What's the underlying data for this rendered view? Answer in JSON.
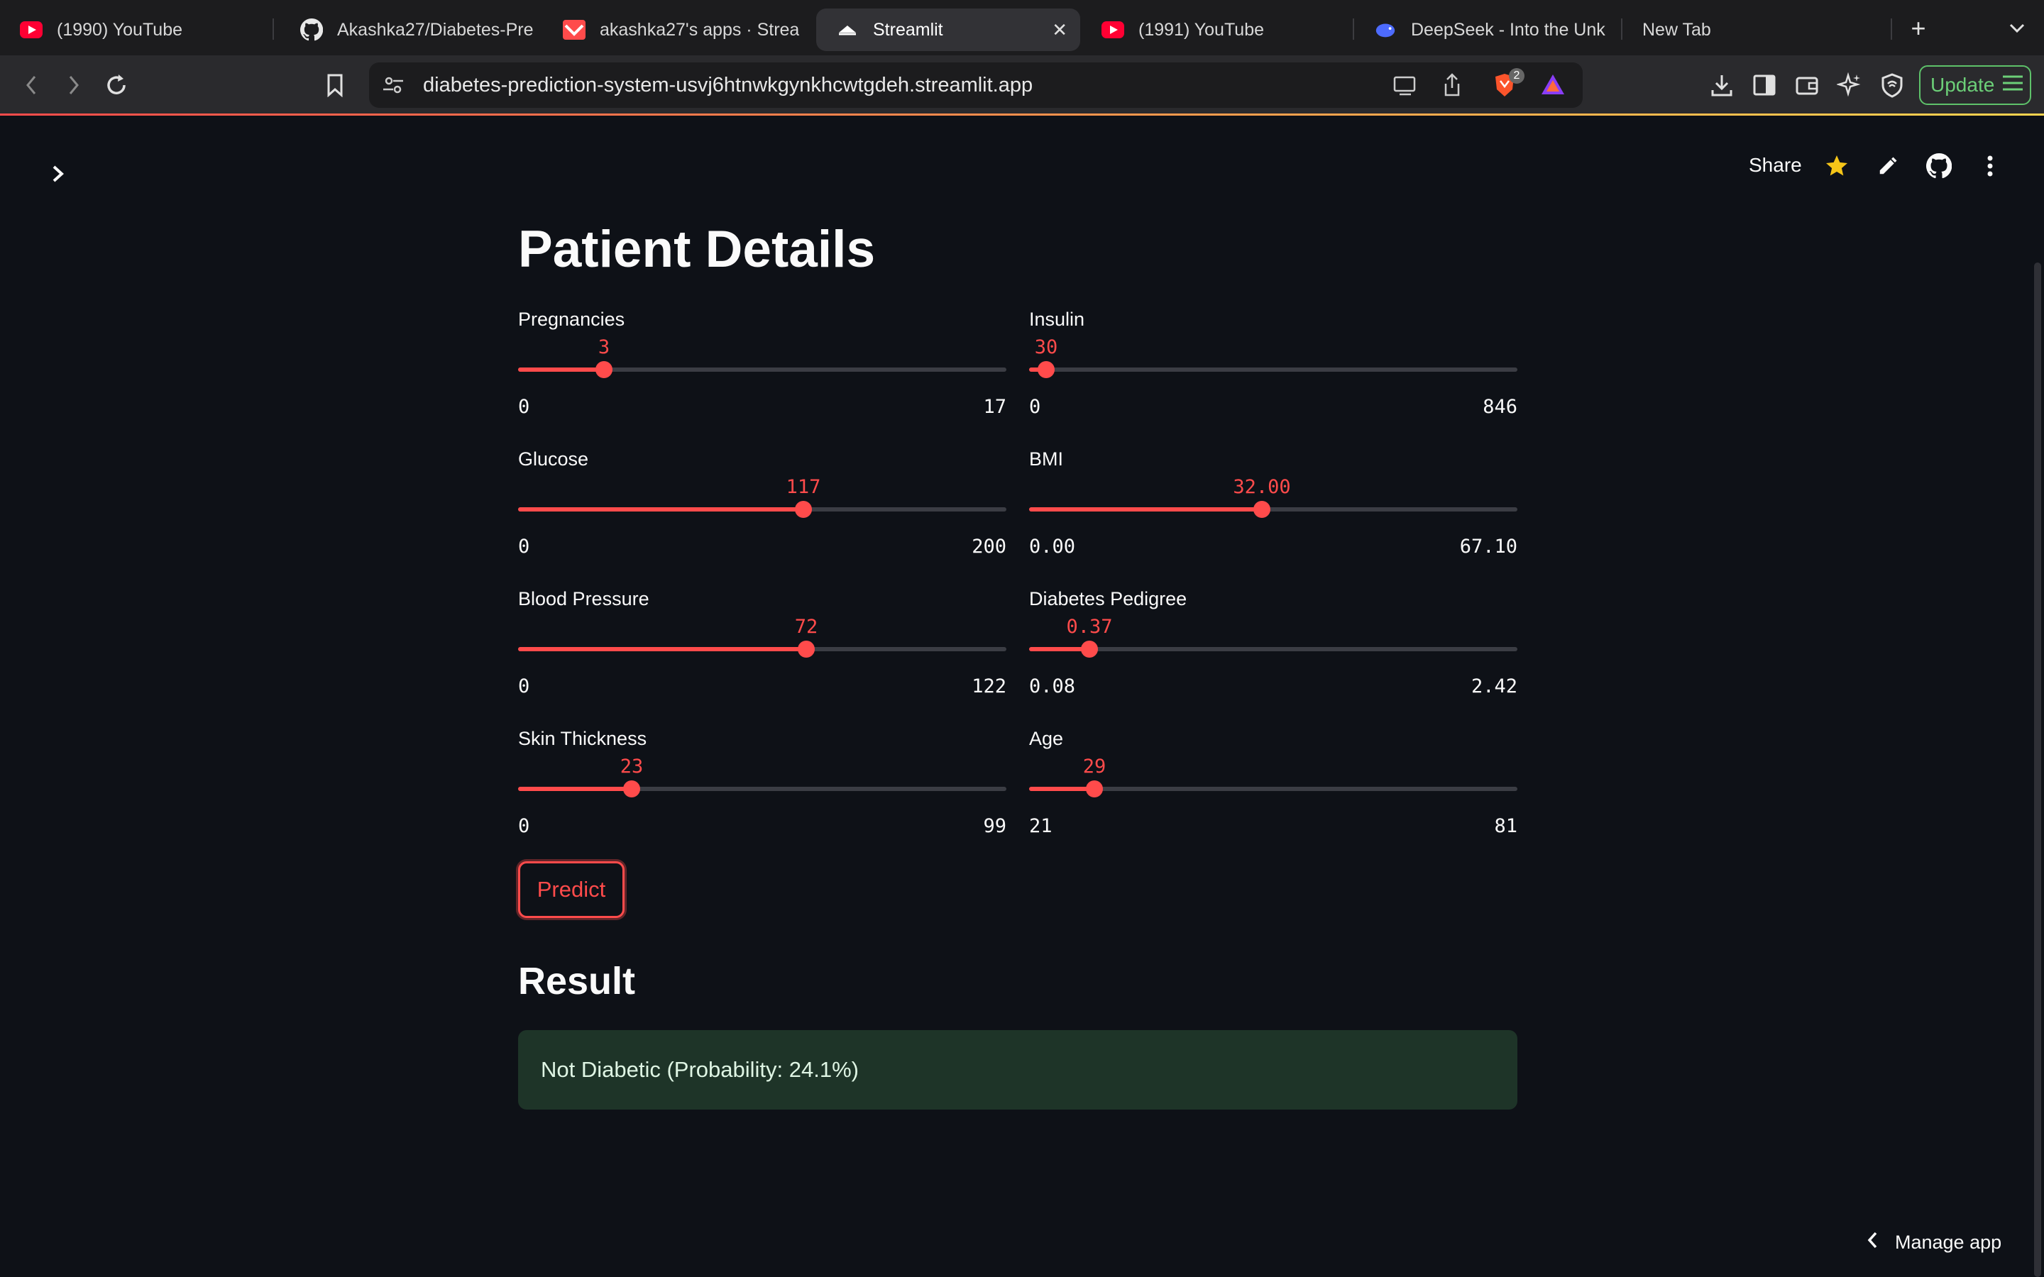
{
  "browser": {
    "tabs": [
      {
        "title": "(1990) YouTube",
        "icon": "youtube-icon",
        "active": false
      },
      {
        "title": "Akashka27/Diabetes-Pre",
        "icon": "github-icon",
        "active": false
      },
      {
        "title": "akashka27's apps · Strea",
        "icon": "streamlit-icon",
        "active": false
      },
      {
        "title": "Streamlit",
        "icon": "streamlit-icon",
        "active": true
      },
      {
        "title": "(1991) YouTube",
        "icon": "youtube-icon",
        "active": false
      },
      {
        "title": "DeepSeek - Into the Unk",
        "icon": "deepseek-icon",
        "active": false
      },
      {
        "title": "New Tab",
        "icon": "",
        "active": false
      }
    ],
    "url": "diabetes-prediction-system-usvj6htnwkgynkhcwtgdeh.streamlit.app",
    "shields_count": "2",
    "update_label": "Update"
  },
  "app_header": {
    "share_label": "Share"
  },
  "page": {
    "title": "Patient Details",
    "accent_color": "#ff4b4b",
    "sliders": [
      {
        "label": "Pregnancies",
        "value": "3",
        "min": "0",
        "max": "17",
        "fraction": 0.176
      },
      {
        "label": "Insulin",
        "value": "30",
        "min": "0",
        "max": "846",
        "fraction": 0.035
      },
      {
        "label": "Glucose",
        "value": "117",
        "min": "0",
        "max": "200",
        "fraction": 0.585
      },
      {
        "label": "BMI",
        "value": "32.00",
        "min": "0.00",
        "max": "67.10",
        "fraction": 0.477
      },
      {
        "label": "Blood Pressure",
        "value": "72",
        "min": "0",
        "max": "122",
        "fraction": 0.59
      },
      {
        "label": "Diabetes Pedigree",
        "value": "0.37",
        "min": "0.08",
        "max": "2.42",
        "fraction": 0.124
      },
      {
        "label": "Skin Thickness",
        "value": "23",
        "min": "0",
        "max": "99",
        "fraction": 0.232
      },
      {
        "label": "Age",
        "value": "29",
        "min": "21",
        "max": "81",
        "fraction": 0.133
      }
    ],
    "predict_label": "Predict",
    "result_title": "Result",
    "result_text": "Not Diabetic (Probability: 24.1%)"
  },
  "footer": {
    "manage_app_label": "Manage app"
  }
}
